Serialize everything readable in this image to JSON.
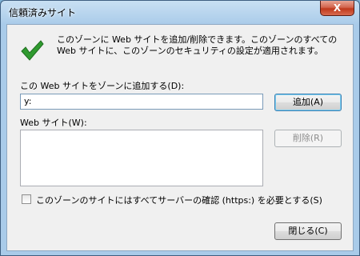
{
  "window": {
    "title": "信頼済みサイト",
    "close_label": "X"
  },
  "dialog": {
    "description": "このゾーンに Web サイトを追加/削除できます。このゾーンのすべての Web サイトに、このゾーンのセキュリティの設定が適用されます。",
    "icon": "green-check-icon",
    "add_label": "この Web サイトをゾーンに追加する(D):",
    "add_input_value": "y:",
    "add_button": "追加(A)",
    "websites_label": "Web サイト(W):",
    "websites": [],
    "remove_button": "削除(R)",
    "https_checkbox_label": "このゾーンのサイトにはすべてサーバーの確認 (https:) を必要とする(S)",
    "https_checked": false,
    "close_button": "閉じる(C)"
  },
  "colors": {
    "check_green": "#2f9a2f",
    "title_frame": "#a9cbe9",
    "close_red": "#c0391c"
  }
}
